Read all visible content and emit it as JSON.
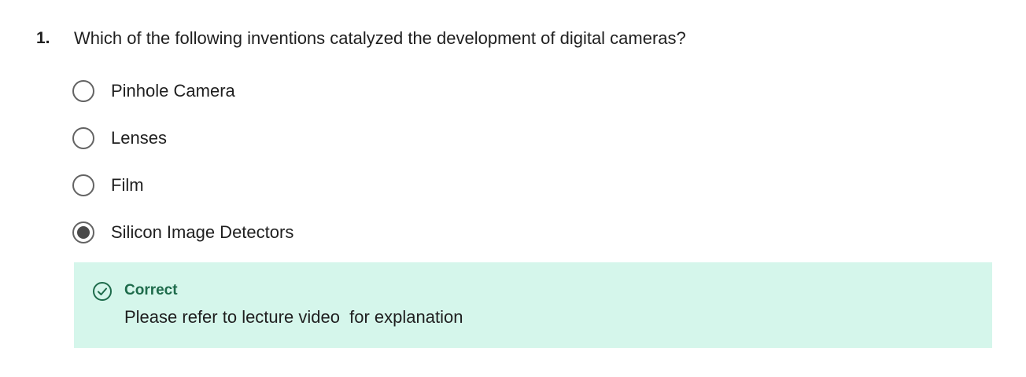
{
  "question": {
    "number": "1.",
    "prompt": "Which of the following inventions catalyzed the development of digital cameras?",
    "options": [
      {
        "label": "Pinhole Camera",
        "selected": false
      },
      {
        "label": "Lenses",
        "selected": false
      },
      {
        "label": "Film",
        "selected": false
      },
      {
        "label": "Silicon Image Detectors",
        "selected": true
      }
    ]
  },
  "feedback": {
    "status": "Correct",
    "message": "Please refer to lecture video  for explanation",
    "icon": "check-circle-icon",
    "background_color": "#d5f6eb",
    "accent_color": "#1e6b4b"
  }
}
